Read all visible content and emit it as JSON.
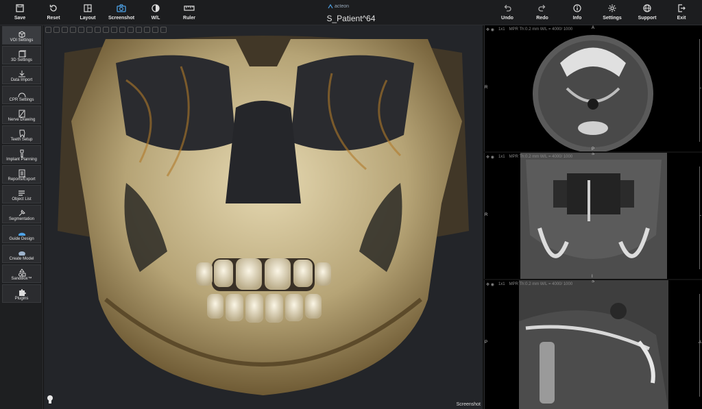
{
  "toolbar": {
    "save": "Save",
    "reset": "Reset",
    "layout": "Layout",
    "screenshot": "Screenshot",
    "wl": "W/L",
    "ruler": "Ruler",
    "undo": "Undo",
    "redo": "Redo",
    "info": "Info",
    "settings": "Settings",
    "support": "Support",
    "exit": "Exit"
  },
  "brand": "acteon",
  "patient_title": "S_Patient^64",
  "sidebar": {
    "items": [
      {
        "label": "VOI Settings",
        "icon": "cube-icon"
      },
      {
        "label": "3D Settings",
        "icon": "cube-settings-icon"
      },
      {
        "label": "Data Import",
        "icon": "download-icon"
      },
      {
        "label": "CPR Settings",
        "icon": "arch-icon"
      },
      {
        "label": "Nerve Drawing",
        "icon": "nerve-icon"
      },
      {
        "label": "Teeth Setup",
        "icon": "tooth-icon"
      },
      {
        "label": "Implant Planning",
        "icon": "implant-icon"
      },
      {
        "label": "Reports/Export",
        "icon": "report-icon"
      },
      {
        "label": "Object List",
        "icon": "list-icon"
      },
      {
        "label": "Segmentation",
        "icon": "segmentation-icon"
      },
      {
        "label": "Guide Design",
        "icon": "guide-icon"
      },
      {
        "label": "Create Model",
        "icon": "model-icon"
      },
      {
        "label": "SandBox™",
        "icon": "shapes-icon"
      },
      {
        "label": "Plugins",
        "icon": "puzzle-icon"
      }
    ]
  },
  "view3d": {
    "screenshot_label": "Screenshot"
  },
  "mpr": [
    {
      "layout": "1x1",
      "info": "MPR   Th:0.2 mm  W/L = 4000/ 1000",
      "left": "R",
      "right": "L",
      "top": "A",
      "bottom": "P"
    },
    {
      "layout": "1x1",
      "info": "MPR   Th:0.2 mm  W/L = 4000/ 1000",
      "left": "R",
      "right": "L",
      "top": "S",
      "bottom": "I"
    },
    {
      "layout": "1x1",
      "info": "MPR   Th:0.2 mm  W/L = 4000/ 1000",
      "left": "P",
      "right": "A",
      "top": "S",
      "bottom": ""
    }
  ],
  "colors": {
    "accent": "#4ea3e8",
    "bone": "#cbbd96",
    "background": "#1c1d1f"
  }
}
